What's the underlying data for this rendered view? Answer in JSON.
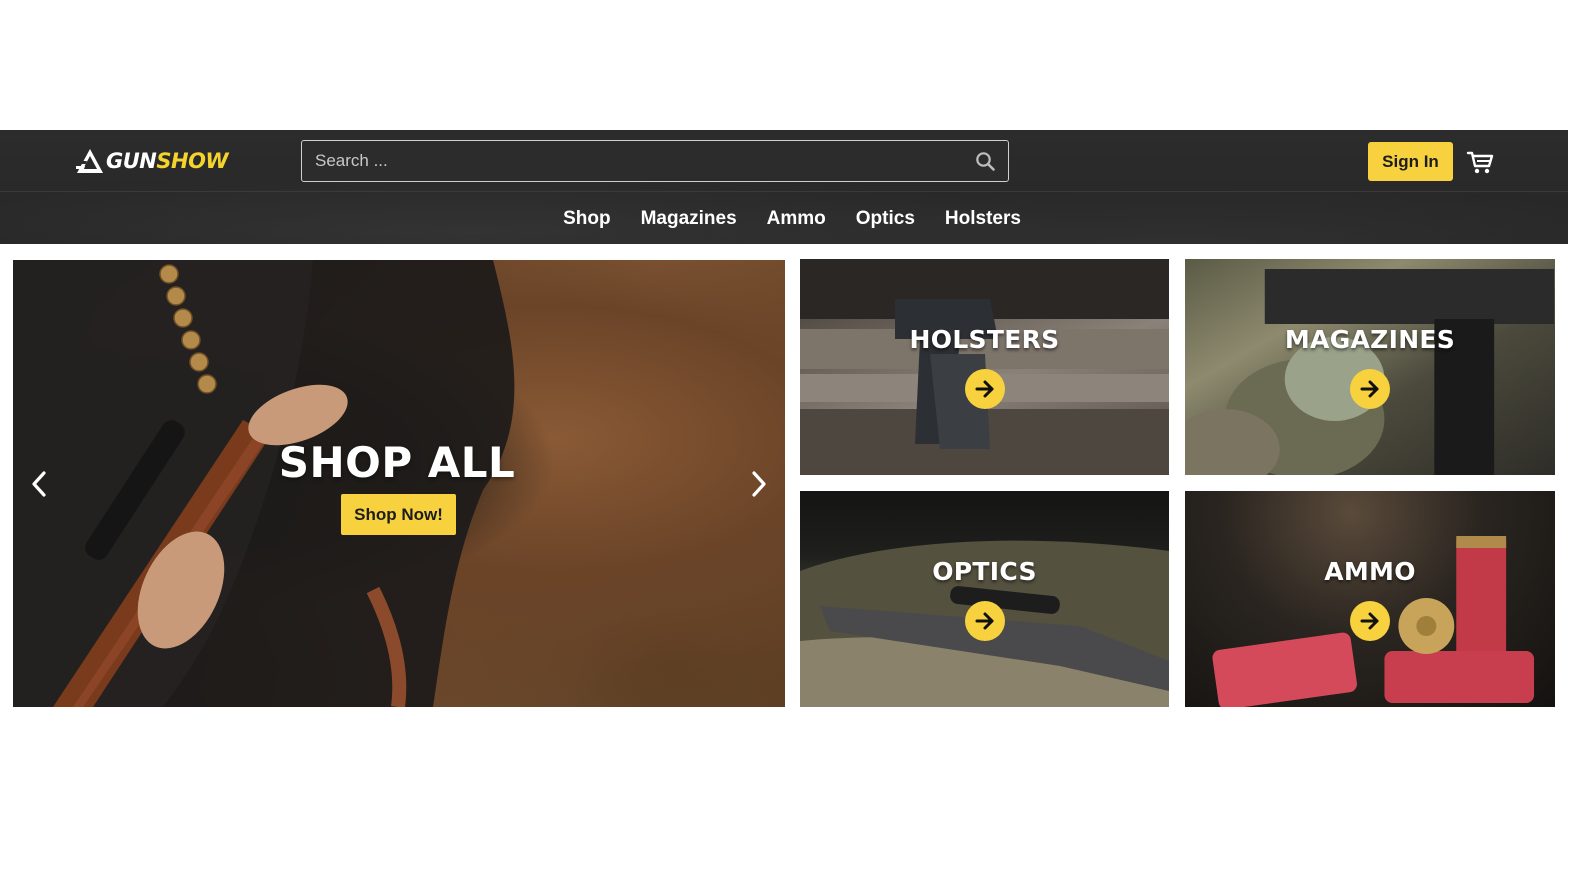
{
  "brand": {
    "logo_part1": "GUN",
    "logo_part2": "SHOW",
    "accent": "#f7d23e",
    "header_bg": "#2b2b2b"
  },
  "search": {
    "placeholder": "Search ...",
    "icon": "search-icon"
  },
  "header": {
    "signin_label": "Sign In",
    "cart_icon": "cart-icon"
  },
  "nav": {
    "items": [
      "Shop",
      "Magazines",
      "Ammo",
      "Optics",
      "Holsters"
    ]
  },
  "hero": {
    "title": "SHOP ALL",
    "button_label": "Shop Now!",
    "prev_icon": "chevron-left-icon",
    "next_icon": "chevron-right-icon"
  },
  "categories": [
    {
      "label": "HOLSTERS",
      "icon": "arrow-right-icon"
    },
    {
      "label": "MAGAZINES",
      "icon": "arrow-right-icon"
    },
    {
      "label": "OPTICS",
      "icon": "arrow-right-icon"
    },
    {
      "label": "AMMO",
      "icon": "arrow-right-icon"
    }
  ]
}
